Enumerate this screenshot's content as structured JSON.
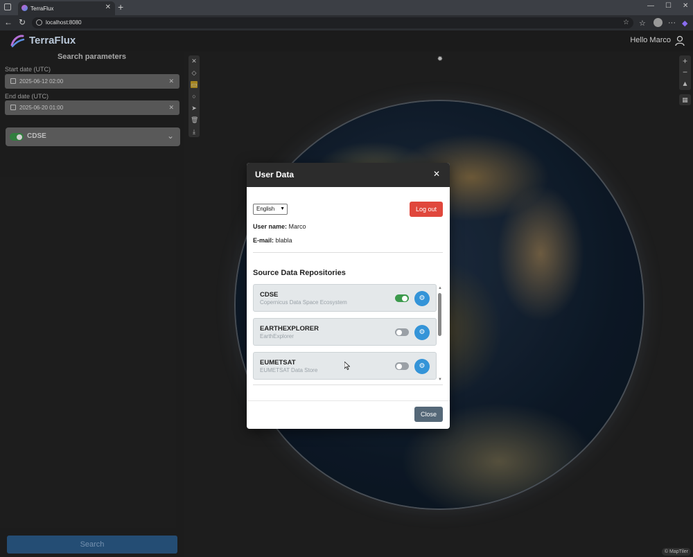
{
  "browser": {
    "tab_title": "TerraFlux",
    "url": "localhost:8080"
  },
  "app": {
    "brand": "TerraFlux",
    "greeting": "Hello Marco"
  },
  "sidebar": {
    "title": "Search parameters",
    "start_label": "Start date (UTC)",
    "start_value": "2025-06-12 02:00",
    "end_label": "End date (UTC)",
    "end_value": "2025-06-20 01:00",
    "repo_name": "CDSE",
    "search_label": "Search"
  },
  "map": {
    "attribution": "© MapTiler"
  },
  "modal": {
    "title": "User Data",
    "language": "English",
    "logout_label": "Log out",
    "username_label": "User name:",
    "username": "Marco",
    "email_label": "E-mail:",
    "email": "blabla",
    "section_title": "Source Data Repositories",
    "repos": [
      {
        "name": "CDSE",
        "desc": "Copernicus Data Space Ecosystem",
        "enabled": true
      },
      {
        "name": "EARTHEXPLORER",
        "desc": "EarthExplorer",
        "enabled": false
      },
      {
        "name": "EUMETSAT",
        "desc": "EUMETSAT Data Store",
        "enabled": false
      }
    ],
    "close_label": "Close"
  },
  "colors": {
    "accent": "#3494d8",
    "logout": "#e0473c",
    "toggle_on": "#3c9a4c"
  }
}
